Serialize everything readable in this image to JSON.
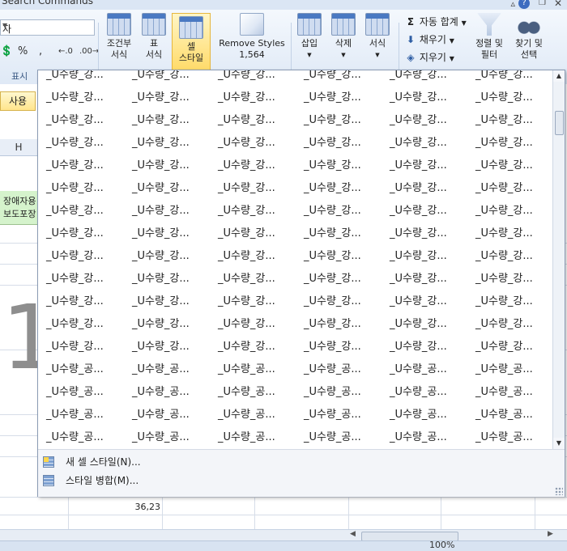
{
  "window": {
    "title": "Search Commands"
  },
  "ribbon": {
    "font_name": "자",
    "number_format": {
      "percent": "%",
      "comma": ","
    },
    "group_label_number": "표시",
    "conditional_format": {
      "line1": "조건부",
      "line2": "서식"
    },
    "format_table": {
      "line1": "표",
      "line2": "서식"
    },
    "cell_styles": {
      "line1": "셀",
      "line2": "스타일"
    },
    "remove_styles": {
      "line1": "Remove Styles",
      "line2": "1,564"
    },
    "insert": "삽입",
    "delete": "삭제",
    "format": "서식",
    "autosum": "자동 합계",
    "fill": "채우기",
    "clear": "지우기",
    "sort_filter": {
      "line1": "정렬 및",
      "line2": "필터"
    },
    "find_select": {
      "line1": "찾기 및",
      "line2": "선택"
    }
  },
  "sheet": {
    "styled_cell_text": "사용",
    "column_header": "H",
    "green_cell_line1": "장애자용",
    "green_cell_line2": "보도포장",
    "big_number": "1",
    "cell_value": "36,23"
  },
  "gallery": {
    "styles": [
      [
        "_U수량_강...",
        "_U수량_강...",
        "_U수량_강...",
        "_U수량_강...",
        "_U수량_강...",
        "_U수량_강..."
      ],
      [
        "_U수량_강...",
        "_U수량_강...",
        "_U수량_강...",
        "_U수량_강...",
        "_U수량_강...",
        "_U수량_강..."
      ],
      [
        "_U수량_강...",
        "_U수량_강...",
        "_U수량_강...",
        "_U수량_강...",
        "_U수량_강...",
        "_U수량_강..."
      ],
      [
        "_U수량_강...",
        "_U수량_강...",
        "_U수량_강...",
        "_U수량_강...",
        "_U수량_강...",
        "_U수량_강..."
      ],
      [
        "_U수량_강...",
        "_U수량_강...",
        "_U수량_강...",
        "_U수량_강...",
        "_U수량_강...",
        "_U수량_강..."
      ],
      [
        "_U수량_강...",
        "_U수량_강...",
        "_U수량_강...",
        "_U수량_강...",
        "_U수량_강...",
        "_U수량_강..."
      ],
      [
        "_U수량_강...",
        "_U수량_강...",
        "_U수량_강...",
        "_U수량_강...",
        "_U수량_강...",
        "_U수량_강..."
      ],
      [
        "_U수량_강...",
        "_U수량_강...",
        "_U수량_강...",
        "_U수량_강...",
        "_U수량_강...",
        "_U수량_강..."
      ],
      [
        "_U수량_강...",
        "_U수량_강...",
        "_U수량_강...",
        "_U수량_강...",
        "_U수량_강...",
        "_U수량_강..."
      ],
      [
        "_U수량_강...",
        "_U수량_강...",
        "_U수량_강...",
        "_U수량_강...",
        "_U수량_강...",
        "_U수량_강..."
      ],
      [
        "_U수량_강...",
        "_U수량_강...",
        "_U수량_강...",
        "_U수량_강...",
        "_U수량_강...",
        "_U수량_강..."
      ],
      [
        "_U수량_강...",
        "_U수량_강...",
        "_U수량_강...",
        "_U수량_강...",
        "_U수량_강...",
        "_U수량_강..."
      ],
      [
        "_U수량_강...",
        "_U수량_강...",
        "_U수량_강...",
        "_U수량_강...",
        "_U수량_강...",
        "_U수량_강..."
      ],
      [
        "_U수량_공...",
        "_U수량_공...",
        "_U수량_공...",
        "_U수량_공...",
        "_U수량_공...",
        "_U수량_공..."
      ],
      [
        "_U수량_공...",
        "_U수량_공...",
        "_U수량_공...",
        "_U수량_공...",
        "_U수량_공...",
        "_U수량_공..."
      ],
      [
        "_U수량_공...",
        "_U수량_공...",
        "_U수량_공...",
        "_U수량_공...",
        "_U수량_공...",
        "_U수량_공..."
      ],
      [
        "_U수량_공...",
        "_U수량_공...",
        "_U수량_공...",
        "_U수량_공...",
        "_U수량_공...",
        "_U수량_공..."
      ]
    ],
    "menu": {
      "new_style": "새 셀 스타일(N)...",
      "merge_styles": "스타일 병합(M)..."
    }
  },
  "status": {
    "zoom": "100%"
  },
  "colors": {
    "accent": "#ffd964",
    "ribbon_bg": "#dfe9f6",
    "green_cell": "#d5f3cc"
  },
  "icons": [
    "help-icon",
    "conditional-format-icon",
    "format-table-icon",
    "cell-styles-icon",
    "remove-styles-icon",
    "insert-cells-icon",
    "delete-cells-icon",
    "format-cells-icon",
    "sigma-icon",
    "fill-down-icon",
    "eraser-icon",
    "sort-filter-icon",
    "binoculars-icon",
    "new-style-icon",
    "merge-styles-icon"
  ]
}
